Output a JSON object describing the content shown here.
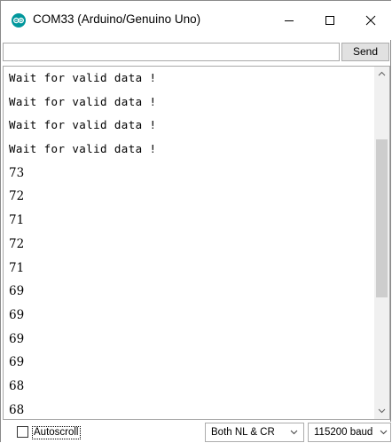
{
  "window": {
    "title": "COM33 (Arduino/Genuino Uno)",
    "icon": "arduino-logo-icon",
    "controls": [
      "minimize-icon",
      "maximize-icon",
      "close-icon"
    ]
  },
  "send_row": {
    "input_value": "",
    "send_label": "Send"
  },
  "output": {
    "lines": [
      "Wait for valid data !",
      "Wait for valid data !",
      "Wait for valid data !",
      "Wait for valid data !",
      "73",
      "72",
      "71",
      "72",
      "71",
      "69",
      "69",
      "69",
      "69",
      "68",
      "68"
    ]
  },
  "bottom_bar": {
    "autoscroll_label": "Autoscroll",
    "autoscroll_checked": false,
    "line_ending": "Both NL & CR",
    "baud_rate": "115200 baud"
  },
  "colors": {
    "accent": "#00979c",
    "scrollbar_track": "#f0f0f0",
    "scrollbar_thumb": "#cdcdcd",
    "button_bg": "#e1e1e1"
  }
}
